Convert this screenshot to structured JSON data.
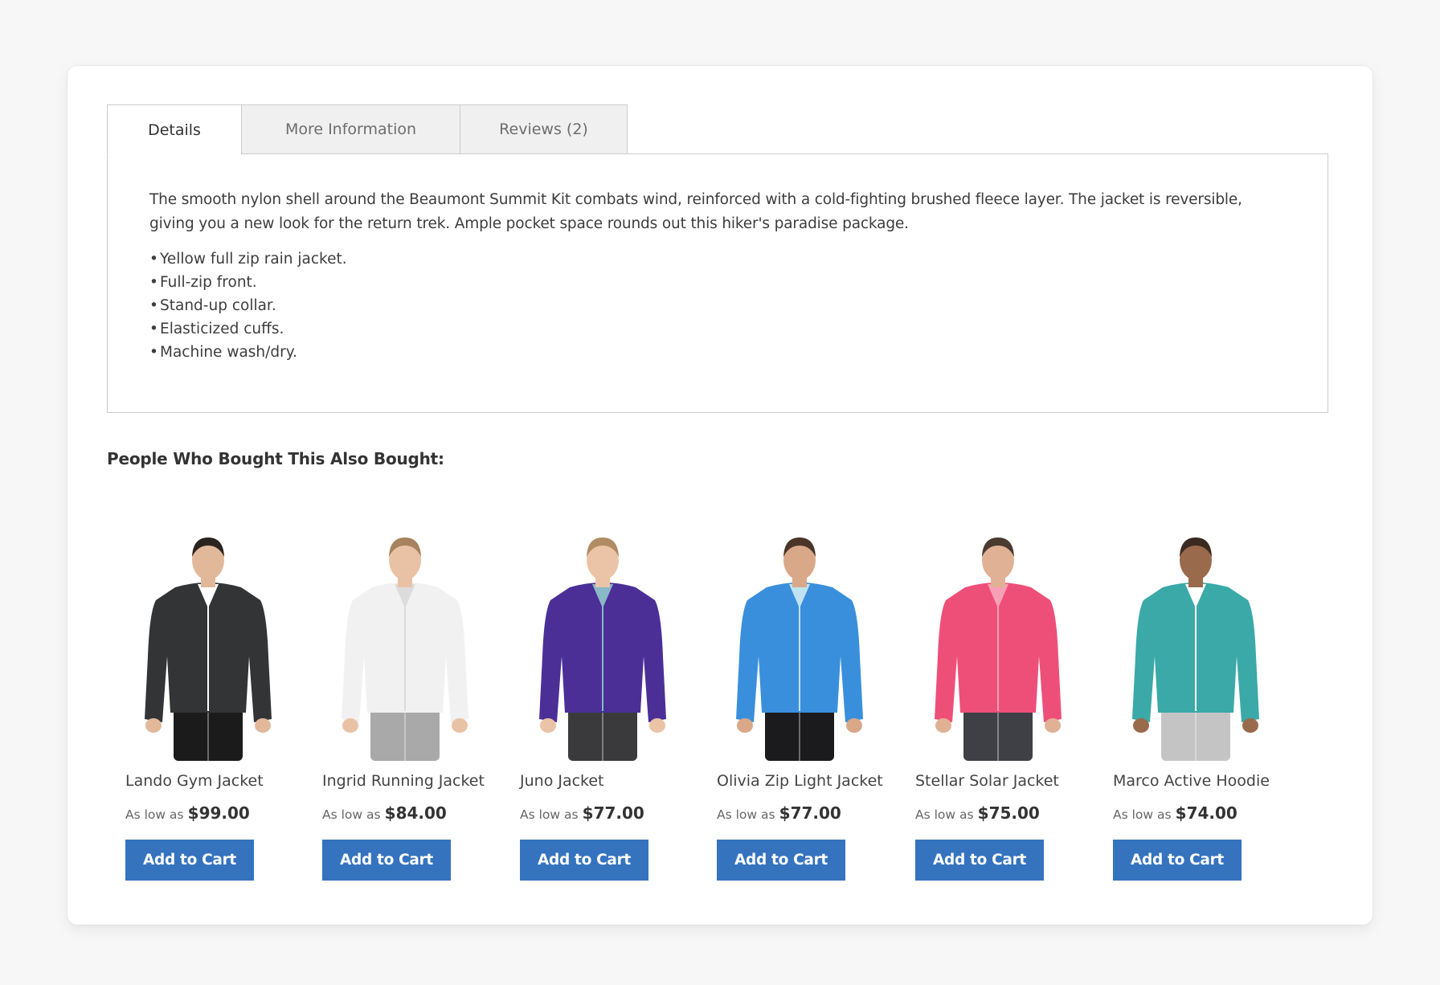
{
  "tabs": [
    {
      "label": "Details",
      "active": true
    },
    {
      "label": "More Information",
      "active": false
    },
    {
      "label": "Reviews (2)",
      "active": false
    }
  ],
  "details": {
    "description": "The smooth nylon shell around the Beaumont Summit Kit combats wind, reinforced with a cold-fighting brushed fleece layer. The jacket is reversible, giving you a new look for the return trek. Ample pocket space rounds out this hiker's paradise package.",
    "bullet_glyph": "•",
    "features": [
      "Yellow full zip rain jacket.",
      "Full-zip front.",
      "Stand-up collar.",
      "Elasticized cuffs.",
      "Machine wash/dry."
    ]
  },
  "also_bought": {
    "heading": "People Who Bought This Also Bought:",
    "price_prefix": "As low as",
    "button_label": "Add to Cart",
    "button_color": "#3573bf",
    "products": [
      {
        "name": "Lando Gym Jacket",
        "price": "$99.00",
        "jacket_color": "#333436",
        "pants_color": "#1b1b1c",
        "hair_color": "#2a2420",
        "skin_color": "#e2b89b",
        "inner_color": "#ffffff"
      },
      {
        "name": "Ingrid Running Jacket",
        "price": "$84.00",
        "jacket_color": "#f1f1f1",
        "pants_color": "#a9a9a9",
        "hair_color": "#a6825f",
        "skin_color": "#e9c2a6",
        "inner_color": "#dcdcdc"
      },
      {
        "name": "Juno Jacket",
        "price": "$77.00",
        "jacket_color": "#4b2f97",
        "pants_color": "#3a3a3d",
        "hair_color": "#b08b64",
        "skin_color": "#ebc3a6",
        "inner_color": "#8ab8c8"
      },
      {
        "name": "Olivia Zip Light Jacket",
        "price": "$77.00",
        "jacket_color": "#3a8fdc",
        "pants_color": "#1b1b1d",
        "hair_color": "#4a3528",
        "skin_color": "#d9a889",
        "inner_color": "#bfe3f2"
      },
      {
        "name": "Stellar Solar Jacket",
        "price": "$75.00",
        "jacket_color": "#ee4f78",
        "pants_color": "#3f4046",
        "hair_color": "#4b3a30",
        "skin_color": "#e0b194",
        "inner_color": "#f7a0b5"
      },
      {
        "name": "Marco Active Hoodie",
        "price": "$74.00",
        "jacket_color": "#3aa9a8",
        "pants_color": "#c4c4c4",
        "hair_color": "#3a2a20",
        "skin_color": "#9a6a4c",
        "inner_color": "#ffffff"
      }
    ]
  }
}
